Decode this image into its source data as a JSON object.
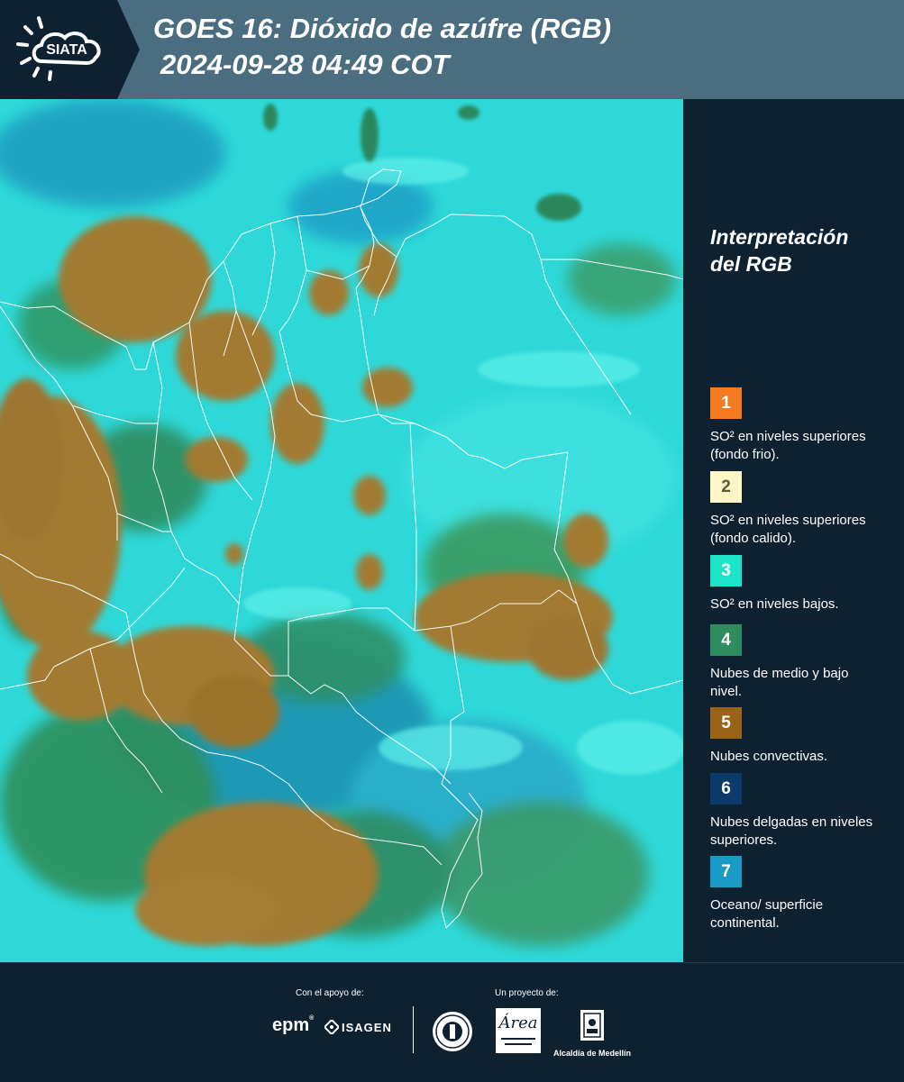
{
  "header": {
    "logo_text": "SIATA",
    "title_line1": "GOES 16: Dióxido de azúfre (RGB)",
    "title_line2": "2024-09-28 04:49 COT"
  },
  "legend": {
    "title_line1": "Interpretación",
    "title_line2": "del RGB",
    "items": [
      {
        "number": "1",
        "label": "SO² en niveles superiores (fondo frio).",
        "color": "#f47b20",
        "text_color": "#ffffff"
      },
      {
        "number": "2",
        "label": "SO² en niveles superiores (fondo calido).",
        "color": "#fff6c8",
        "text_color": "#5a5a3a"
      },
      {
        "number": "3",
        "label": "SO² en niveles bajos.",
        "color": "#1de3c9",
        "text_color": "#ffffff"
      },
      {
        "number": "4",
        "label": "Nubes de medio y bajo nivel.",
        "color": "#2f8c5e",
        "text_color": "#ffffff"
      },
      {
        "number": "5",
        "label": "Nubes convectivas.",
        "color": "#9a6418",
        "text_color": "#ffffff"
      },
      {
        "number": "6",
        "label": "Nubes delgadas en niveles superiores.",
        "color": "#0c3a6b",
        "text_color": "#ffffff"
      },
      {
        "number": "7",
        "label": "Oceano/ superficie continental.",
        "color": "#1a9bc6",
        "text_color": "#ffffff"
      }
    ]
  },
  "footer": {
    "support_label": "Con el apoyo de:",
    "project_label": "Un proyecto de:",
    "epm_text": "epm",
    "isagen_text": "ISAGEN",
    "metropolitana_text": "Área",
    "alcaldia_text": "Alcaldía de Medellín"
  },
  "colors": {
    "header_bg": "#4a6d80",
    "page_bg": "#0d2131",
    "map_background": "#2ed8d8",
    "convective_cloud": "#a27a30",
    "mid_low_cloud": "#2f8c5e",
    "border_line": "#ffffff"
  }
}
